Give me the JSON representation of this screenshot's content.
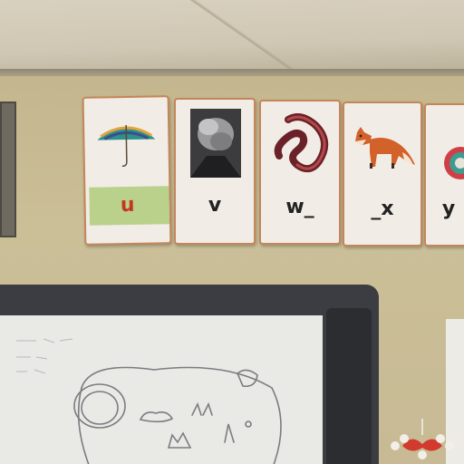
{
  "alphabet_cards": [
    {
      "letter": "u",
      "picture": "umbrella-icon"
    },
    {
      "letter": "v",
      "picture": "volcano-photo"
    },
    {
      "letter": "w_",
      "picture": "worm-icon"
    },
    {
      "letter": "_x",
      "picture": "fox-icon"
    },
    {
      "letter": "y",
      "picture": "yarn-icon"
    }
  ],
  "colors": {
    "wall": "#c9bc96",
    "card_border": "#c4865a",
    "u_highlight": "#b9d18a",
    "u_letter": "#c8351f",
    "board_frame": "#3b3d42"
  }
}
